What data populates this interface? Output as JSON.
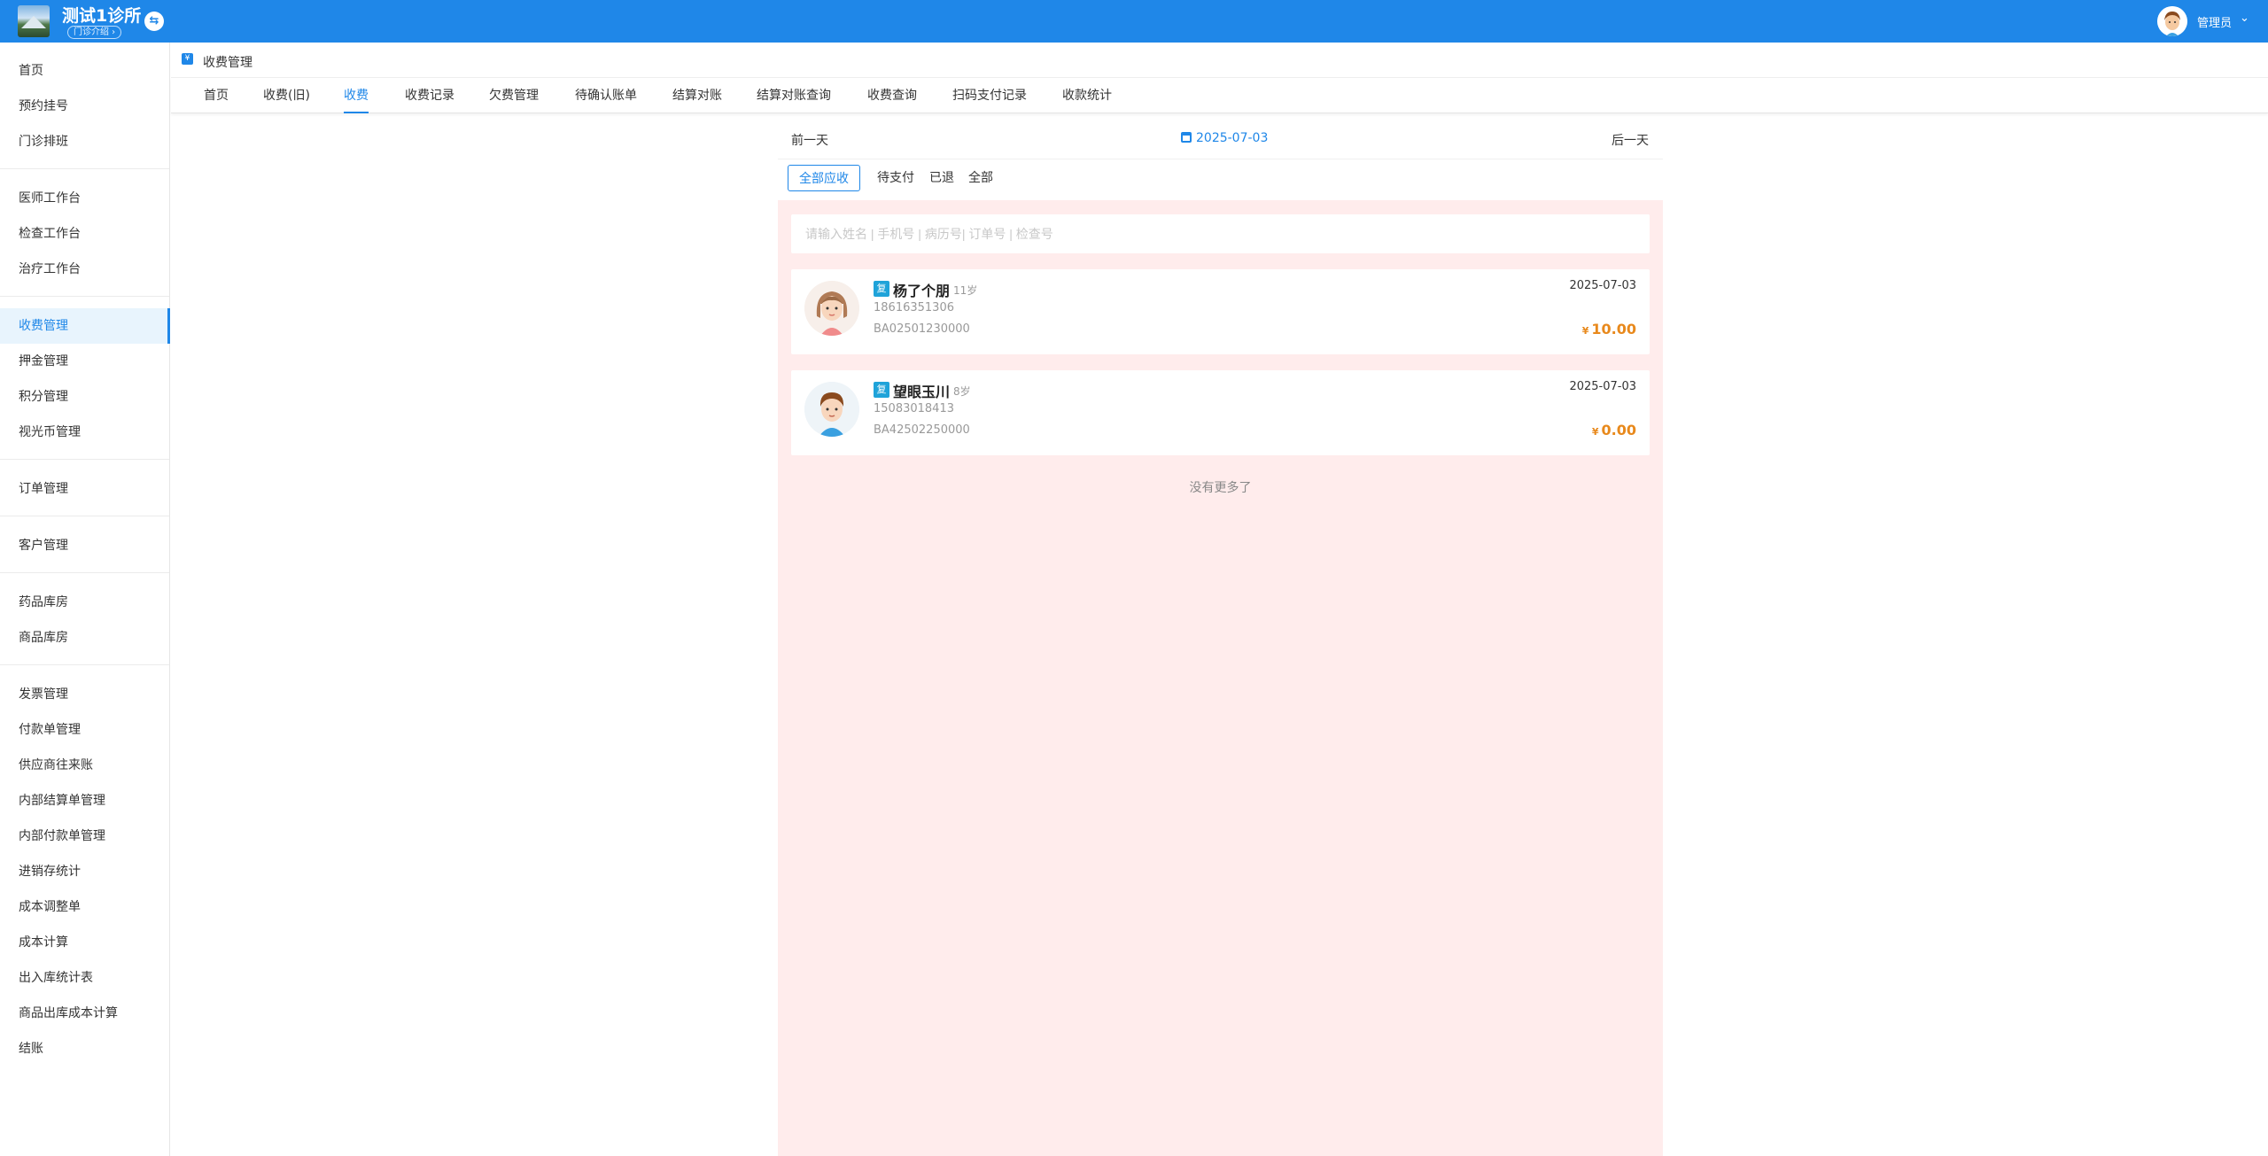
{
  "header": {
    "clinic_name": "测试1诊所",
    "clinic_badge": "门诊介绍 ›",
    "switch_icon": "swap-icon",
    "user_name": "管理员",
    "brand_color": "#1f87e8"
  },
  "sidebar": {
    "items": [
      {
        "label": "首页"
      },
      {
        "label": "预约挂号"
      },
      {
        "label": "门诊排班"
      },
      {
        "label": "医师工作台"
      },
      {
        "label": "检查工作台"
      },
      {
        "label": "治疗工作台"
      },
      {
        "label": "收费管理",
        "active": true
      },
      {
        "label": "押金管理"
      },
      {
        "label": "积分管理"
      },
      {
        "label": "视光币管理"
      },
      {
        "label": "订单管理"
      },
      {
        "label": "客户管理"
      },
      {
        "label": "药品库房"
      },
      {
        "label": "商品库房"
      },
      {
        "label": "发票管理"
      },
      {
        "label": "付款单管理"
      },
      {
        "label": "供应商往来账"
      },
      {
        "label": "内部结算单管理"
      },
      {
        "label": "内部付款单管理"
      },
      {
        "label": "进销存统计"
      },
      {
        "label": "成本调整单"
      },
      {
        "label": "成本计算"
      },
      {
        "label": "出入库统计表"
      },
      {
        "label": "商品出库成本计算"
      },
      {
        "label": "结账"
      }
    ]
  },
  "breadcrumb": {
    "icon_text": "¥",
    "title": "收费管理"
  },
  "tabs": [
    {
      "label": "首页"
    },
    {
      "label": "收费(旧)"
    },
    {
      "label": "收费",
      "active": true
    },
    {
      "label": "收费记录"
    },
    {
      "label": "欠费管理"
    },
    {
      "label": "待确认账单"
    },
    {
      "label": "结算对账"
    },
    {
      "label": "结算对账查询"
    },
    {
      "label": "收费查询"
    },
    {
      "label": "扫码支付记录"
    },
    {
      "label": "收款统计"
    }
  ],
  "datebar": {
    "prev_label": "前一天",
    "date": "2025-07-03",
    "next_label": "后一天"
  },
  "filters": [
    {
      "label": "全部应收",
      "active": true
    },
    {
      "label": "待支付"
    },
    {
      "label": "已退"
    },
    {
      "label": "全部"
    }
  ],
  "search": {
    "placeholder": "请输入姓名 | 手机号 | 病历号| 订单号 | 检查号"
  },
  "records": [
    {
      "tag": "复",
      "name": "杨了个朋",
      "age": "11岁",
      "phone": "18616351306",
      "record_no": "BA02501230000",
      "date": "2025-07-03",
      "currency": "¥",
      "amount": "10.00",
      "avatar": "female-avatar-icon"
    },
    {
      "tag": "复",
      "name": "望眼玉川",
      "age": "8岁",
      "phone": "15083018413",
      "record_no": "BA42502250000",
      "date": "2025-07-03",
      "currency": "¥",
      "amount": "0.00",
      "avatar": "male-avatar-icon"
    }
  ],
  "list_footer": "没有更多了",
  "colors": {
    "accent": "#1f87e8",
    "list_background": "#ffecec",
    "amount": "#e8891c",
    "tag": "#1fa3d9"
  }
}
